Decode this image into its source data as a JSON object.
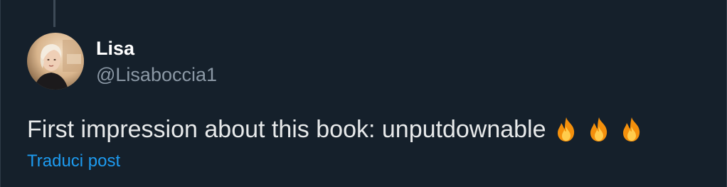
{
  "author": {
    "display_name": "Lisa",
    "handle": "@Lisaboccia1"
  },
  "post": {
    "text": "First impression about this book: unputdownable",
    "emojis": [
      "fire-icon",
      "fire-icon",
      "fire-icon"
    ]
  },
  "actions": {
    "translate_label": "Traduci post"
  },
  "colors": {
    "background": "#15202b",
    "text": "#e7e9ea",
    "secondary_text": "#8b98a5",
    "link": "#1d9bf0"
  }
}
